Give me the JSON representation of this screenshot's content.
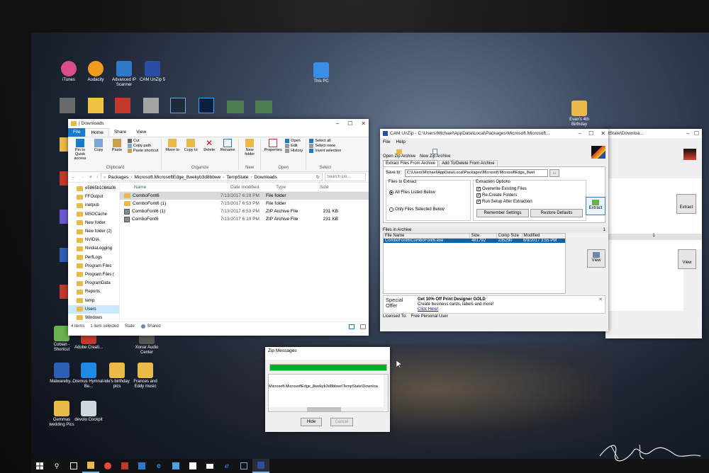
{
  "desktop": {
    "icons": [
      {
        "label": "iTunes",
        "color": "#d84d8e"
      },
      {
        "label": "Audacity",
        "color": "#f29b1d"
      },
      {
        "label": "Advanced IP Scanner",
        "color": "#2f79c9"
      },
      {
        "label": "CAM UnZip 5",
        "color": "#2a4fa2"
      },
      {
        "label": "This PC",
        "color": "#3a8ee6"
      },
      {
        "label": "Evan's 4th Birthday",
        "color": "#e9b949"
      },
      {
        "label": "Adobe Creati...",
        "color": "#c0392b"
      },
      {
        "label": "Cobian - Shortcut",
        "color": "#6ab04c"
      },
      {
        "label": "Xonar Audio Center",
        "color": "#555555"
      },
      {
        "label": "Malwareby...",
        "color": "#2d5fb3"
      },
      {
        "label": "Oremus Hymnal- Be...",
        "color": "#1e88e5"
      },
      {
        "label": "Ide's birthday pics",
        "color": "#e9b949"
      },
      {
        "label": "Frances and Eddy music",
        "color": "#e9b949"
      },
      {
        "label": "Gemmas wedding Pics",
        "color": "#e9b949"
      },
      {
        "label": "devolo Cockpit",
        "color": "#cfd8dc"
      }
    ]
  },
  "explorer": {
    "title": "| Downloads",
    "tabs": [
      "File",
      "Home",
      "Share",
      "View"
    ],
    "ribbon": {
      "clipboard": {
        "label": "Clipboard",
        "pin": "Pin to Quick access",
        "copy": "Copy",
        "paste": "Paste",
        "cut": "Cut",
        "copy_path": "Copy path",
        "paste_shortcut": "Paste shortcut"
      },
      "organize": {
        "label": "Organize",
        "move_to": "Move to",
        "copy_to": "Copy to",
        "delete": "Delete",
        "rename": "Rename"
      },
      "new": {
        "label": "New",
        "new_folder": "New folder"
      },
      "open": {
        "label": "Open",
        "properties": "Properties",
        "open": "Open",
        "edit": "Edit",
        "history": "History"
      },
      "select": {
        "label": "Select",
        "select_all": "Select all",
        "select_none": "Select none",
        "invert": "Invert selection"
      }
    },
    "address": {
      "path": [
        "Packages",
        "Microsoft.MicrosoftEdge_8wekyb3d8bbwe",
        "TempState",
        "Downloads"
      ],
      "search_placeholder": "Search Do..."
    },
    "sidebar": [
      "e5865b1084a06",
      "FFOutput",
      "inetpub",
      "MSOCache",
      "New folder",
      "New folder (2)",
      "NVIDIA",
      "NvidiaLogging",
      "PerfLogs",
      "Program Files",
      "Program Files (",
      "ProgramData",
      "Reports",
      "temp",
      "Users",
      "Windows"
    ],
    "columns": [
      "Name",
      "Date modified",
      "Type",
      "Size"
    ],
    "files": [
      {
        "name": "ComboFont6",
        "date": "7/13/2017 6:19 PM",
        "type": "File folder",
        "size": "",
        "kind": "folder"
      },
      {
        "name": "ComboFont6 (1)",
        "date": "7/13/2017 6:53 PM",
        "type": "File folder",
        "size": "",
        "kind": "folder"
      },
      {
        "name": "ComboFont6 (1)",
        "date": "7/13/2017 6:53 PM",
        "type": "ZIP Archive File",
        "size": "231 KB",
        "kind": "zip"
      },
      {
        "name": "ComboFont6",
        "date": "7/13/2017 6:19 PM",
        "type": "ZIP Archive File",
        "size": "231 KB",
        "kind": "zip"
      }
    ],
    "status": {
      "items": "4 items",
      "selected": "1 item selected",
      "state_label": "State:",
      "state_value": "Shared"
    }
  },
  "camunzip": {
    "title": "CAM UnZip - C:\\Users\\Michael\\AppData\\Local\\Packages\\Microsoft.Microsoft...",
    "menu": [
      "File",
      "Help"
    ],
    "toolbar": [
      "Open Zip Archive",
      "New Zip Archive"
    ],
    "tabs": [
      "Extract Files From Archive",
      "Add To/Delete From Archive"
    ],
    "save_to_label": "Save to:",
    "save_to_value": "C:\\Users\\Michael\\AppData\\Local\\Packages\\Microsoft.MicrosoftEdge_8wel",
    "files_to_extract": {
      "label": "Files to Extract",
      "all": "All Files Listed Below",
      "only": "Only Files Selected Below"
    },
    "extraction_options": {
      "label": "Extraction Options",
      "overwrite": "Overwrite Existing Files",
      "recreate": "Re-Create Folders",
      "run_setup": "Run Setup After Extraction"
    },
    "remember_btn": "Remember Settings",
    "restore_btn": "Restore Defaults",
    "extract_btn": "Extract",
    "view_btn": "View",
    "files_in_archive": "Files in Archive",
    "archive_count": "1",
    "columns": [
      "File Name",
      "Size",
      "Comp Size",
      "Modified"
    ],
    "rows": [
      {
        "name": "ComboFont6\\ComboFont6.exe",
        "size": "481792",
        "comp": "235290",
        "modified": "6/9/2017 3:55 PM"
      }
    ],
    "ad": {
      "special": "Special",
      "offer": "Offer",
      "headline": "Get 10% Off Print Designer GOLD",
      "body": "Create business cards, labels and more!",
      "link": "Click Here!"
    },
    "licensed_label": "Licensed To:",
    "licensed_value": "Free Personal User"
  },
  "camunzip_back": {
    "title": "tState\\Downloa...",
    "extract_btn": "Extract",
    "view_btn": "View",
    "count": "1"
  },
  "zipmsg": {
    "title": "Zip Messages",
    "progress": 1.0,
    "text": "Microsoft.MicrosoftEdge_8wekyb3d8bbwe\\TempState\\Downloa",
    "hide_btn": "Hide",
    "cancel_btn": "Cancel"
  },
  "colors": {
    "accent": "#1979ca",
    "selected": "#cce8ff",
    "progress": "#06b025",
    "cam_select": "#0a64ad"
  }
}
